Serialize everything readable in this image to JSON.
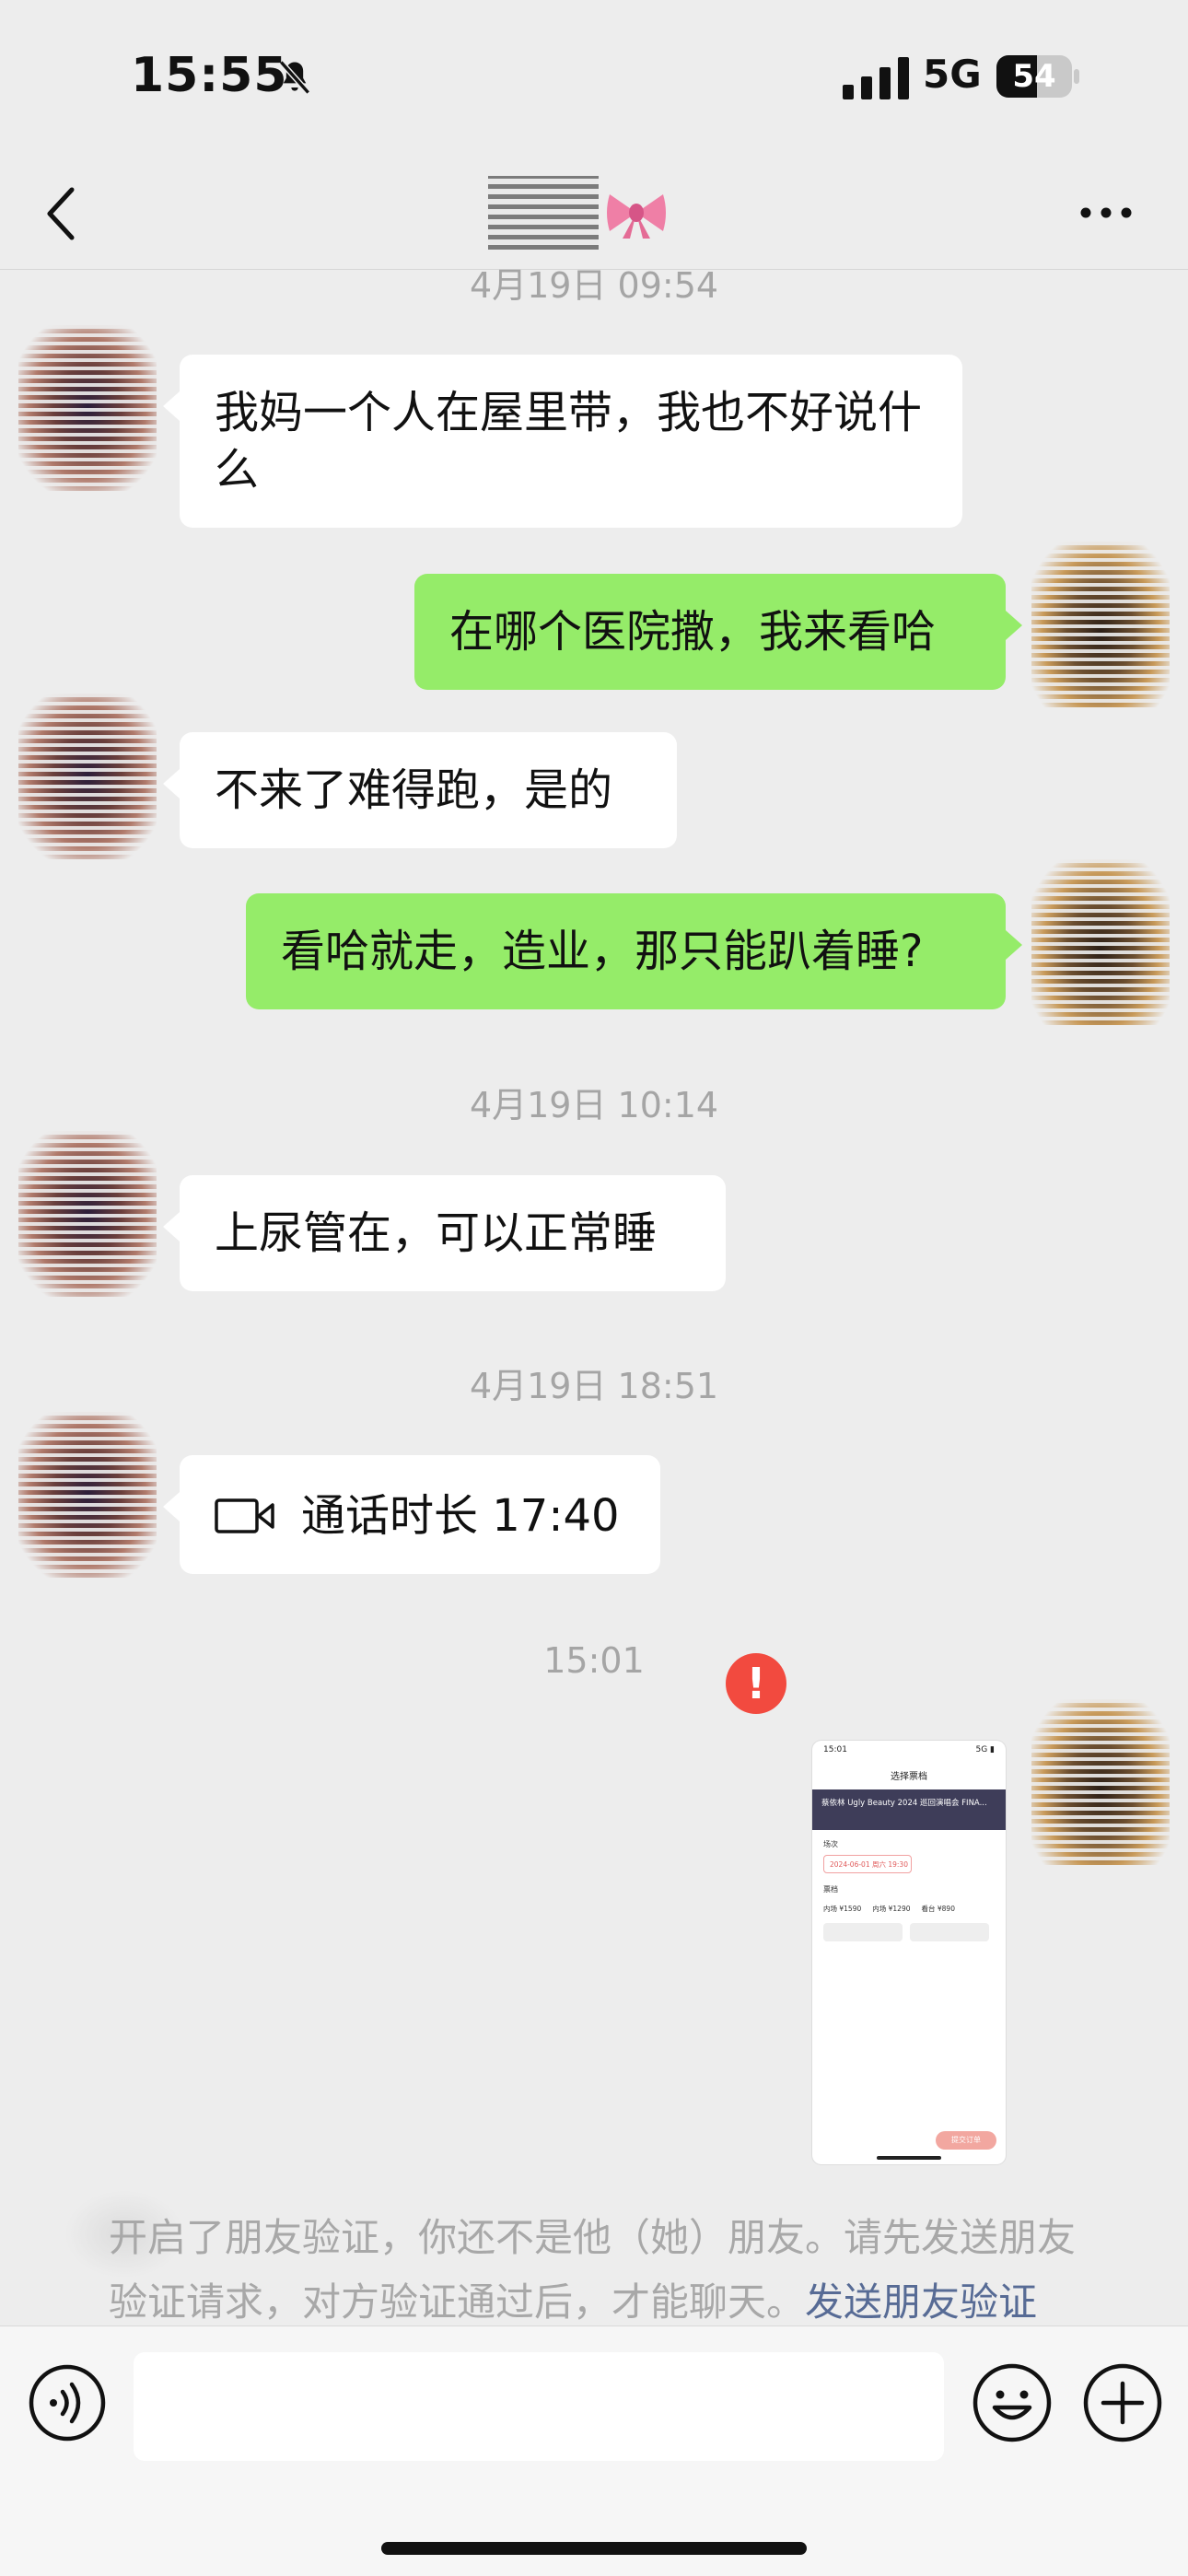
{
  "status_bar": {
    "time": "15:55",
    "network": "5G",
    "battery": "54",
    "battery_level": 0.54
  },
  "icons": {
    "back": "chevron-left-icon",
    "more": "more-dots-icon",
    "bell": "bell-slash-icon",
    "voice": "voice-icon",
    "emoji": "emoji-icon",
    "plus": "plus-icon",
    "video": "video-call-icon",
    "error": "error-icon"
  },
  "colors": {
    "incoming_bubble": "#ffffff",
    "outgoing_bubble": "#95ec69",
    "error": "#f24a3f",
    "link": "#576b95",
    "background": "#ededed"
  },
  "chat": {
    "ts1": "4月19日 09:54",
    "msg1": "我妈一个人在屋里带，我也不好说什么",
    "msg2": "在哪个医院撒，我来看哈",
    "msg3": "不来了难得跑，是的",
    "msg4": "看哈就走，造业，那只能趴着睡?",
    "ts2": "4月19日 10:14",
    "msg5": "上尿管在，可以正常睡",
    "ts3": "4月19日 18:51",
    "call": "通话时长 17:40",
    "ts4": "15:01",
    "error_mark": "!"
  },
  "screenshot_preview": {
    "time": "15:01",
    "header": "选择票档",
    "banner": "蔡依林 Ugly Beauty 2024 巡回演唱会 FINA...",
    "section_session": "场次",
    "date": "2024-06-01 周六 19:30",
    "section_price": "票档",
    "prices": [
      "内场 ¥1590",
      "内场 ¥1290",
      "看台 ¥890"
    ],
    "buy": "提交订单"
  },
  "notice": {
    "text": "开启了朋友验证，你还不是他（她）朋友。请先发送朋友验证请求，对方验证通过后，才能聊天。",
    "link": "发送朋友验证"
  },
  "input": {
    "value": "",
    "placeholder": ""
  }
}
